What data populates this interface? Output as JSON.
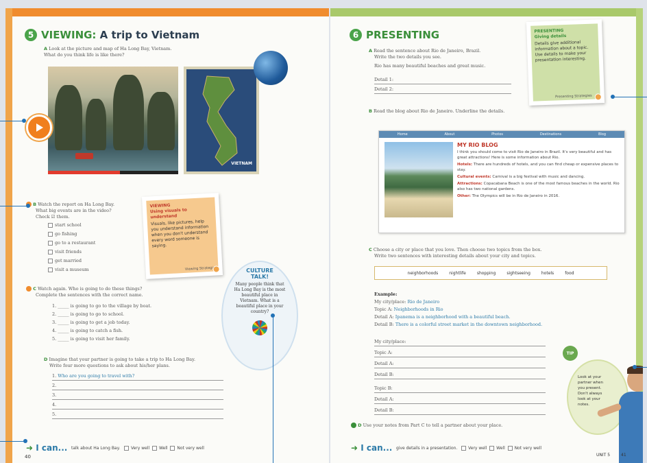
{
  "left": {
    "viewing": {
      "number": "5",
      "title_strong": "VIEWING:",
      "title_rest": "A trip to Vietnam",
      "a_letter": "A",
      "a_text1": "Look at the picture and map of Ha Long Bay, Vietnam.",
      "a_text2": "What do you think life is like there?",
      "map_label": "VIETNAM"
    },
    "b": {
      "letter": "B",
      "text1": "Watch the report on Ha Long Bay.",
      "text2": "What big events are in the video?",
      "text3": "Check ☑ them.",
      "items": [
        "start school",
        "go fishing",
        "go to a restaurant",
        "visit friends",
        "get married",
        "visit a museum"
      ]
    },
    "viewing_note": {
      "heading": "VIEWING",
      "subheading": "Using visuals to understand",
      "body": "Visuals, like pictures, help you understand information when you don't understand every word someone is saying.",
      "footer": "Viewing Strategies"
    },
    "c": {
      "letter": "C",
      "text1": "Watch again. Who is going to do these things?",
      "text2": "Complete the sentences with the correct name.",
      "items": [
        "1. _____ is going to go to the village by boat.",
        "2. _____ is going to go to school.",
        "3. _____ is going to get a job today.",
        "4. _____ is going to catch a fish.",
        "5. _____ is going to visit her family."
      ]
    },
    "culture": {
      "title1": "CULTURE",
      "title2": "TALK!",
      "body": "Many people think that Ha Long Bay is the most beautiful place in Vietnam. What is a beautiful place in your country?"
    },
    "d": {
      "letter": "D",
      "text1": "Imagine that your partner is going to take a trip to Ha Long Bay.",
      "text2": "Write four more questions to ask about his/her plans.",
      "example": "Who are you going to travel with?",
      "nums": [
        "1.",
        "2.",
        "3.",
        "4.",
        "5."
      ]
    },
    "ican": {
      "label": "I can...",
      "text": "talk about Ha Long Bay.",
      "opts": [
        "Very well",
        "Well",
        "Not very well"
      ]
    },
    "page_number": "40"
  },
  "right": {
    "presenting": {
      "number": "6",
      "title": "PRESENTING",
      "a_letter": "A",
      "a_text1": "Read the sentence about Rio de Janeiro, Brazil.",
      "a_text2": "Write the two details you see.",
      "a_sentence": "Rio has many beautiful beaches and great music.",
      "detail1": "Detail 1:",
      "detail2": "Detail 2:"
    },
    "presenting_note": {
      "heading": "PRESENTING",
      "subheading": "Giving details",
      "body": "Details give additional information about a topic. Use details to make your presentation interesting.",
      "footer": "Presenting Strategies"
    },
    "b": {
      "letter": "B",
      "text": "Read the blog about Rio de Janeiro. Underline the details."
    },
    "blog": {
      "nav": [
        "Home",
        "About",
        "Photos",
        "Destinations",
        "Blog"
      ],
      "title": "MY RIO BLOG",
      "intro": "I think you should come to visit Rio de Janeiro in Brazil. It's very beautiful and has great attractions! Here is some information about Rio.",
      "hotels_label": "Hotels:",
      "hotels": "There are hundreds of hotels, and you can find cheap or expensive places to stay.",
      "cultural_label": "Cultural events:",
      "cultural": "Carnival is a big festival with music and dancing.",
      "attractions_label": "Attractions:",
      "attractions": "Copacabana Beach is one of the most famous beaches in the world. Rio also has two national gardens.",
      "other_label": "Other:",
      "other": "The Olympics will be in Rio de Janeiro in 2016."
    },
    "c": {
      "letter": "C",
      "text1": "Choose a city or place that you love. Then choose two topics from the box.",
      "text2": "Write two sentences with interesting details about your city and topics.",
      "topics": [
        "neighborhoods",
        "nightlife",
        "shopping",
        "sightseeing",
        "hotels",
        "food"
      ],
      "example_label": "Example:",
      "ex_city_label": "My city/place:",
      "ex_city": "Rio de Janeiro",
      "ex_topic_label": "Topic A:",
      "ex_topic": "Neighborhoods in Rio",
      "ex_detail_a_label": "Detail A:",
      "ex_detail_a": "Ipanema is a neighborhood with a beautiful beach.",
      "ex_detail_b_label": "Detail B:",
      "ex_detail_b": "There is a colorful street market in the downtown neighborhood.",
      "blank_labels": [
        "My city/place:",
        "Topic A:",
        "Detail A:",
        "Detail B:",
        "Topic B:",
        "Detail A:",
        "Detail B:"
      ]
    },
    "tip": {
      "heading": "TIP",
      "body": "Look at your partner when you present. Don't always look at your notes."
    },
    "d": {
      "letter": "D",
      "text": "Use your notes from Part C to tell a partner about your place."
    },
    "ican": {
      "label": "I can...",
      "text": "give details in a presentation.",
      "opts": [
        "Very well",
        "Well",
        "Not very well"
      ]
    },
    "unit": "UNIT 5",
    "page_number": "41"
  },
  "colors": {
    "orange": "#f08c2e",
    "green": "#3a8f3a",
    "lime": "#a9c96a",
    "callout": "#2272b6"
  }
}
